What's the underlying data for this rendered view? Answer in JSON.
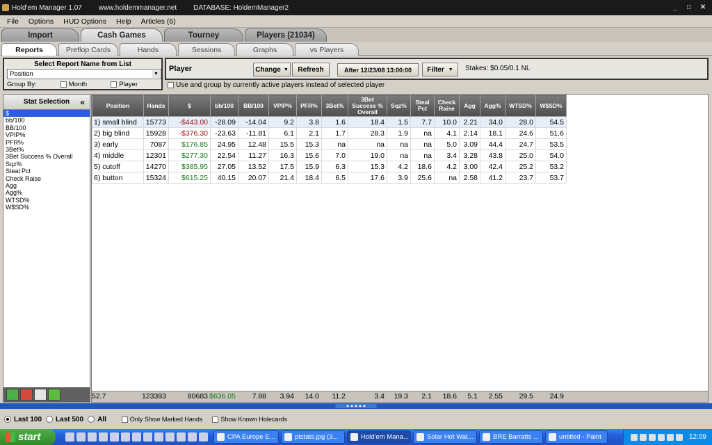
{
  "window": {
    "app_title": "Hold'em Manager 1.07",
    "url": "www.holdemmanager.net",
    "database": "DATABASE: HoldemManager2"
  },
  "menu": [
    "File",
    "Options",
    "HUD Options",
    "Help",
    "Articles (6)"
  ],
  "main_tabs": [
    "Import",
    "Cash Games",
    "Tourney",
    "Players (21034)"
  ],
  "sub_tabs": [
    "Reports",
    "Preflop Cards",
    "Hands",
    "Sessions",
    "Graphs",
    "vs Players"
  ],
  "report_select": {
    "title": "Select Report Name from List",
    "value": "Position",
    "group_by_label": "Group By:",
    "month_label": "Month",
    "player_label": "Player"
  },
  "player_panel": {
    "label": "Player",
    "change_label": "Change",
    "refresh_label": "Refresh",
    "date_label": "After 12/23/08 13:00:00",
    "filter_label": "Filter",
    "stakes": "Stakes: $0.05/0.1 NL",
    "active_players_label": "Use and group by currently active players instead of selected player"
  },
  "stat_selection": {
    "title": "Stat Selection",
    "items": [
      "$",
      "bb/100",
      "BB/100",
      "VPIP%",
      "PFR%",
      "3Bet%",
      "3Bet Success % Overall",
      "Sqz%",
      "Steal Pct",
      "Check Raise",
      "Agg",
      "Agg%",
      "WTSD%",
      "W$SD%"
    ]
  },
  "table": {
    "columns": [
      "Position",
      "Hands",
      "$",
      "bb/100",
      "BB/100",
      "VPIP%",
      "PFR%",
      "3Bet%",
      "3Bet Success % Overall",
      "Sqz%",
      "Steal Pct",
      "Check Raise",
      "Agg",
      "Agg%",
      "WTSD%",
      "W$SD%"
    ],
    "rows": [
      [
        "1) small blind",
        "15773",
        "-$443.00",
        "-28.09",
        "-14.04",
        "9.2",
        "3.8",
        "1.6",
        "18.4",
        "1.5",
        "7.7",
        "10.0",
        "2.21",
        "34.0",
        "28.0",
        "54.5"
      ],
      [
        "2) big blind",
        "15928",
        "-$376.30",
        "-23.63",
        "-11.81",
        "6.1",
        "2.1",
        "1.7",
        "28.3",
        "1.9",
        "na",
        "4.1",
        "2.14",
        "18.1",
        "24.6",
        "51.6"
      ],
      [
        "3) early",
        "7087",
        "$176.85",
        "24.95",
        "12.48",
        "15.5",
        "15.3",
        "na",
        "na",
        "na",
        "na",
        "5.0",
        "3.09",
        "44.4",
        "24.7",
        "53.5"
      ],
      [
        "4) middle",
        "12301",
        "$277.30",
        "22.54",
        "11.27",
        "16.3",
        "15.6",
        "7.0",
        "19.0",
        "na",
        "na",
        "3.4",
        "3.28",
        "43.8",
        "25.0",
        "54.0"
      ],
      [
        "5) cutoff",
        "14270",
        "$385.95",
        "27.05",
        "13.52",
        "17.5",
        "15.9",
        "6.3",
        "15.3",
        "4.2",
        "18.6",
        "4.2",
        "3.00",
        "42.4",
        "25.2",
        "53.2"
      ],
      [
        "6) button",
        "15324",
        "$615.25",
        "40.15",
        "20.07",
        "21.4",
        "18.4",
        "6.5",
        "17.6",
        "3.9",
        "25.6",
        "na",
        "2.58",
        "41.2",
        "23.7",
        "53.7"
      ]
    ],
    "totals": [
      "123393",
      "80683",
      "$636.05",
      "7.88",
      "3.94",
      "14.0",
      "11.2",
      "3.4",
      "19.3",
      "2.1",
      "18.6",
      "5.1",
      "2.55",
      "29.5",
      "24.9",
      "52.7"
    ]
  },
  "bottom": {
    "last100": "Last 100",
    "last500": "Last 500",
    "all": "All",
    "marked": "Only Show Marked Hands",
    "known": "Show Known Holecards"
  },
  "taskbar": {
    "start": "start",
    "buttons": [
      "CPA Europe E...",
      "ptstats.jpg (3...",
      "Hold'em Mana...",
      "Solar Hot Wat...",
      "BRE Barratts ...",
      "untitled - Paint"
    ],
    "clock": "12:09"
  },
  "colors": {
    "negative": "#a01010",
    "positive": "#157a15",
    "selection": "#2a5de0",
    "taskbar": "#245edb"
  }
}
